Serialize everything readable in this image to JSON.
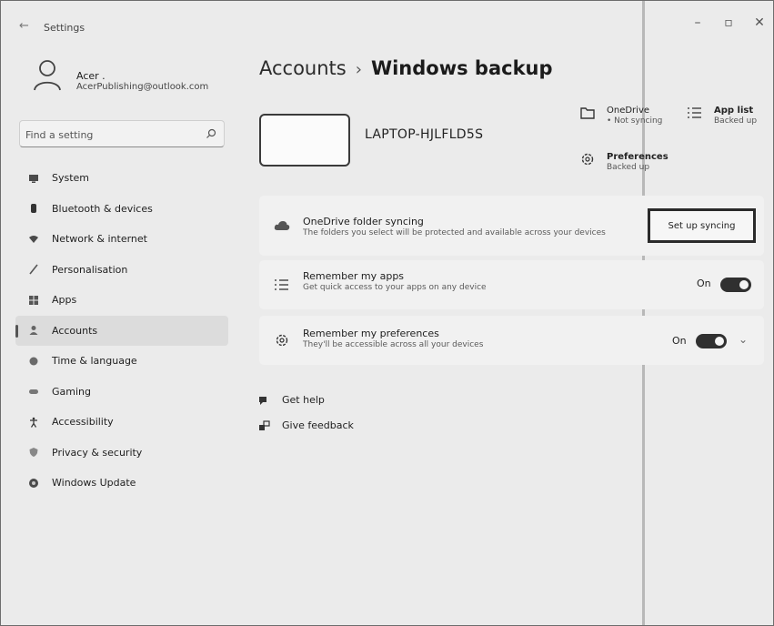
{
  "window": {
    "title": "Settings"
  },
  "user": {
    "name": "Acer .",
    "email": "AcerPublishing@outlook.com"
  },
  "search": {
    "placeholder": "Find a setting"
  },
  "nav": [
    {
      "label": "System",
      "icon": "monitor-icon"
    },
    {
      "label": "Bluetooth & devices",
      "icon": "bluetooth-icon"
    },
    {
      "label": "Network & internet",
      "icon": "wifi-icon"
    },
    {
      "label": "Personalisation",
      "icon": "brush-icon"
    },
    {
      "label": "Apps",
      "icon": "apps-icon"
    },
    {
      "label": "Accounts",
      "icon": "person-icon",
      "active": true
    },
    {
      "label": "Time & language",
      "icon": "globe-clock-icon"
    },
    {
      "label": "Gaming",
      "icon": "gamepad-icon"
    },
    {
      "label": "Accessibility",
      "icon": "accessibility-icon"
    },
    {
      "label": "Privacy & security",
      "icon": "shield-icon"
    },
    {
      "label": "Windows Update",
      "icon": "update-icon"
    }
  ],
  "breadcrumb": {
    "parent": "Accounts",
    "separator": "›",
    "current": "Windows backup"
  },
  "device": {
    "name": "LAPTOP-HJLFLD5S"
  },
  "status": {
    "onedrive": {
      "title": "OneDrive",
      "sub": "• Not syncing"
    },
    "applist": {
      "title": "App list",
      "sub": "Backed up"
    },
    "preferences": {
      "title": "Preferences",
      "sub": "Backed up"
    }
  },
  "cards": {
    "onedrive": {
      "title": "OneDrive folder syncing",
      "desc": "The folders you select will be protected and available across your devices",
      "button": "Set up syncing"
    },
    "apps": {
      "title": "Remember my apps",
      "desc": "Get quick access to your apps on any device",
      "toggle": "On"
    },
    "prefs": {
      "title": "Remember my preferences",
      "desc": "They'll be accessible across all your devices",
      "toggle": "On"
    }
  },
  "links": {
    "help": "Get help",
    "feedback": "Give feedback"
  },
  "colors": {
    "toggle_on": "#303030",
    "background": "#ebebeb",
    "card": "#f1f1f1"
  }
}
